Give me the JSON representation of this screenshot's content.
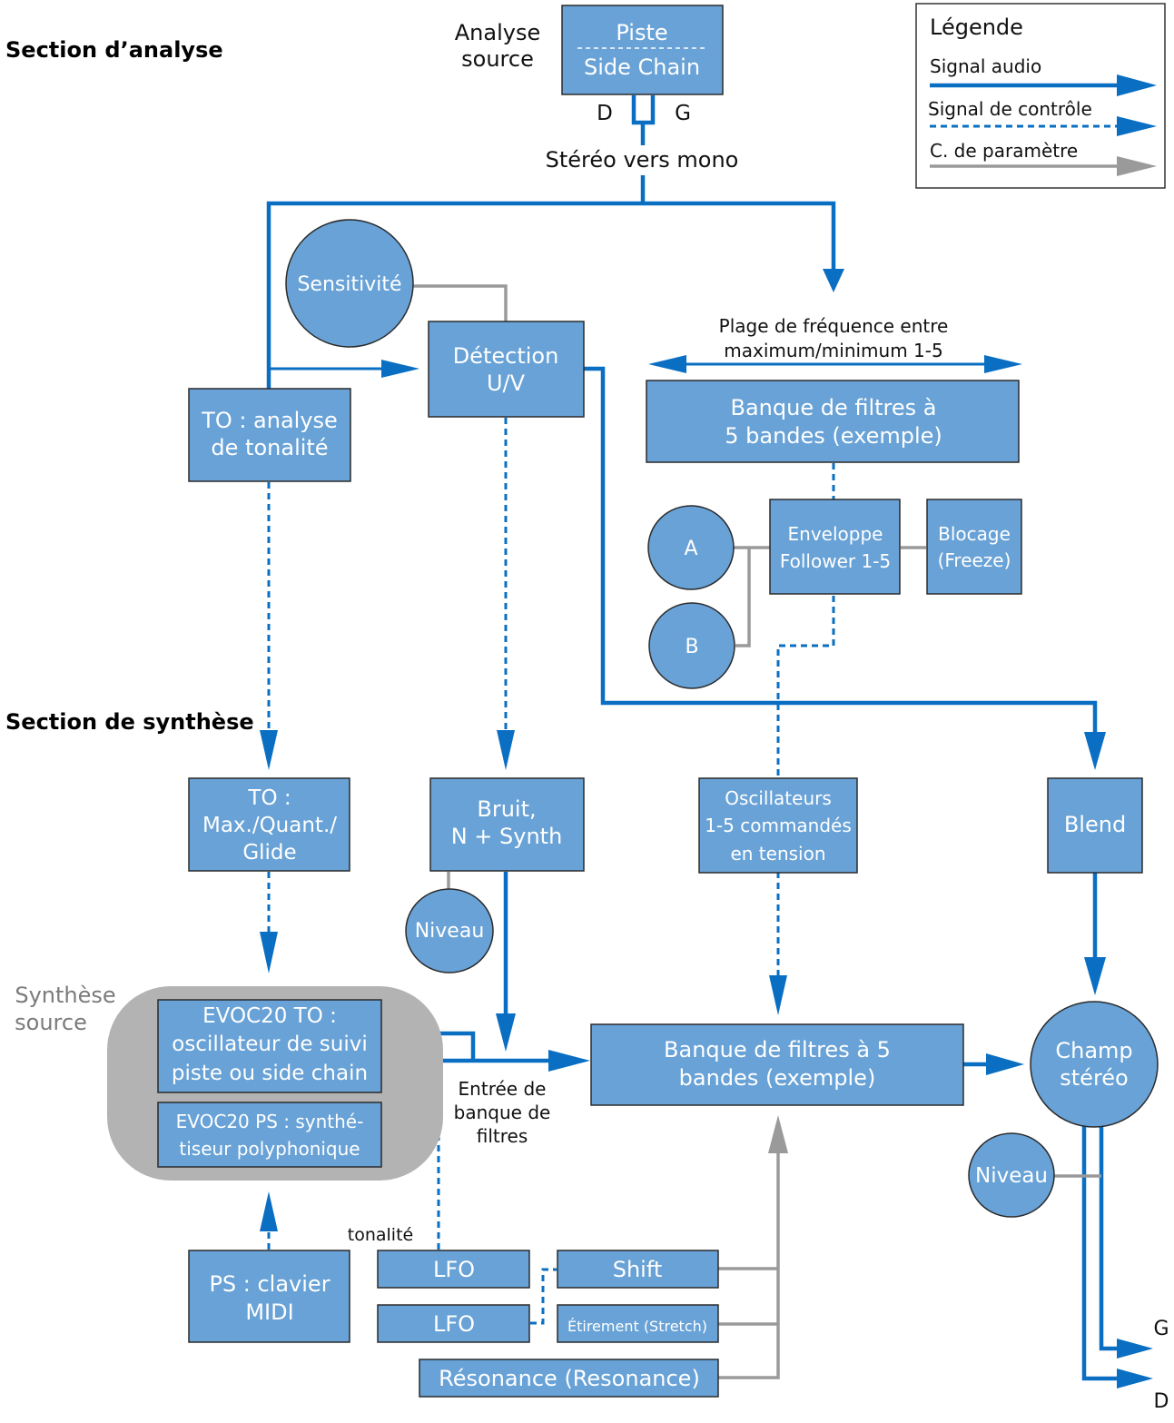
{
  "sections": {
    "analysis": "Section d’analyse",
    "synthesis": "Section de synthèse"
  },
  "legend": {
    "title": "Légende",
    "items": [
      {
        "label": "Signal audio",
        "style": "solid-blue"
      },
      {
        "label": "Signal de contrôle",
        "style": "dashed-blue"
      },
      {
        "label": "C. de paramètre",
        "style": "solid-gray"
      }
    ]
  },
  "colors": {
    "block_fill": "#68a2d6",
    "audio": "#0a6fc2",
    "control": "#0a6fc2",
    "parameter": "#9a9a9a",
    "source_group": "#b3b3b3"
  },
  "labels": {
    "analyse_source": [
      "Analyse",
      "source"
    ],
    "channel_d": "D",
    "channel_g": "G",
    "stereo_to_mono": "Stéréo vers mono",
    "freq_range": [
      "Plage de fréquence entre",
      "maximum/minimum 1-5"
    ],
    "synth_source": [
      "Synthèse",
      "source"
    ],
    "filter_input": [
      "Entrée de",
      "banque de",
      "filtres"
    ],
    "tonalite": "tonalité",
    "out_g": "G",
    "out_d": "D"
  },
  "blocks": {
    "piste": {
      "line1": "Piste",
      "line2": "Side Chain"
    },
    "sensitivite": "Sensitivité",
    "detection": [
      "Détection",
      "U/V"
    ],
    "to_analyse": [
      "TO : analyse",
      "de tonalité"
    ],
    "banque_analyse": [
      "Banque de filtres à",
      "5 bandes (exemple)"
    ],
    "a": "A",
    "b": "B",
    "enveloppe": [
      "Enveloppe",
      "Follower 1-5"
    ],
    "blocage": [
      "Blocage",
      "(Freeze)"
    ],
    "to_max": [
      "TO :",
      "Max./Quant./",
      "Glide"
    ],
    "bruit": [
      "Bruit,",
      "N + Synth"
    ],
    "niveau_bruit": "Niveau",
    "oscillateurs": [
      "Oscillateurs",
      "1-5 commandés",
      "en tension"
    ],
    "blend": "Blend",
    "evoc_to": [
      "EVOC20 TO :",
      "oscillateur de suivi",
      "piste ou side chain"
    ],
    "evoc_ps": [
      "EVOC20 PS : synthé-",
      "tiseur polyphonique"
    ],
    "banque_synth": [
      "Banque de filtres à 5",
      "bandes (exemple)"
    ],
    "champ": [
      "Champ",
      "stéréo"
    ],
    "niveau_out": "Niveau",
    "ps_clavier": [
      "PS : clavier",
      "MIDI"
    ],
    "lfo1": "LFO",
    "lfo2": "LFO",
    "shift": "Shift",
    "stretch": "Étirement (Stretch)",
    "resonance": "Résonance (Resonance)"
  }
}
